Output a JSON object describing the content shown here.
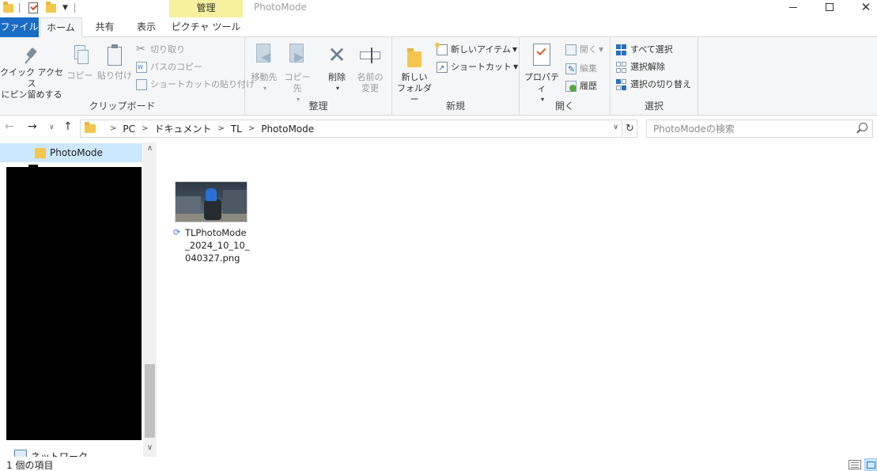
{
  "window": {
    "title": "PhotoMode",
    "context_tab": "管理"
  },
  "ribbon": {
    "tabs": {
      "file": "ファイル",
      "home": "ホーム",
      "share": "共有",
      "view": "表示",
      "picture_tools": "ピクチャ ツール"
    },
    "clipboard": {
      "group_label": "クリップボード",
      "pin_line1": "クイック アクセス",
      "pin_line2": "にピン留めする",
      "copy": "コピー",
      "paste": "貼り付け",
      "cut": "切り取り",
      "copy_path": "パスのコピー",
      "paste_shortcut": "ショートカットの貼り付け"
    },
    "organize": {
      "group_label": "整理",
      "move_to": "移動先",
      "copy_to": "コピー先",
      "delete": "削除",
      "rename_line1": "名前の",
      "rename_line2": "変更"
    },
    "new": {
      "group_label": "新規",
      "new_folder_line1": "新しい",
      "new_folder_line2": "フォルダー",
      "new_item": "新しいアイテム",
      "shortcut": "ショートカット"
    },
    "open": {
      "group_label": "開く",
      "properties": "プロパティ",
      "open": "開く",
      "edit": "編集",
      "history": "履歴"
    },
    "select": {
      "group_label": "選択",
      "select_all": "すべて選択",
      "select_none": "選択解除",
      "invert": "選択の切り替え"
    }
  },
  "address": {
    "crumbs": [
      "PC",
      "ドキュメント",
      "TL",
      "PhotoMode"
    ],
    "search_placeholder": "PhotoModeの検索"
  },
  "nav_pane": {
    "selected": "PhotoMode",
    "network": "ネットワーク"
  },
  "files": [
    {
      "name": "TLPhotoMode_2024_10_10_040327.png"
    }
  ],
  "status": {
    "item_count": "1 個の項目"
  }
}
